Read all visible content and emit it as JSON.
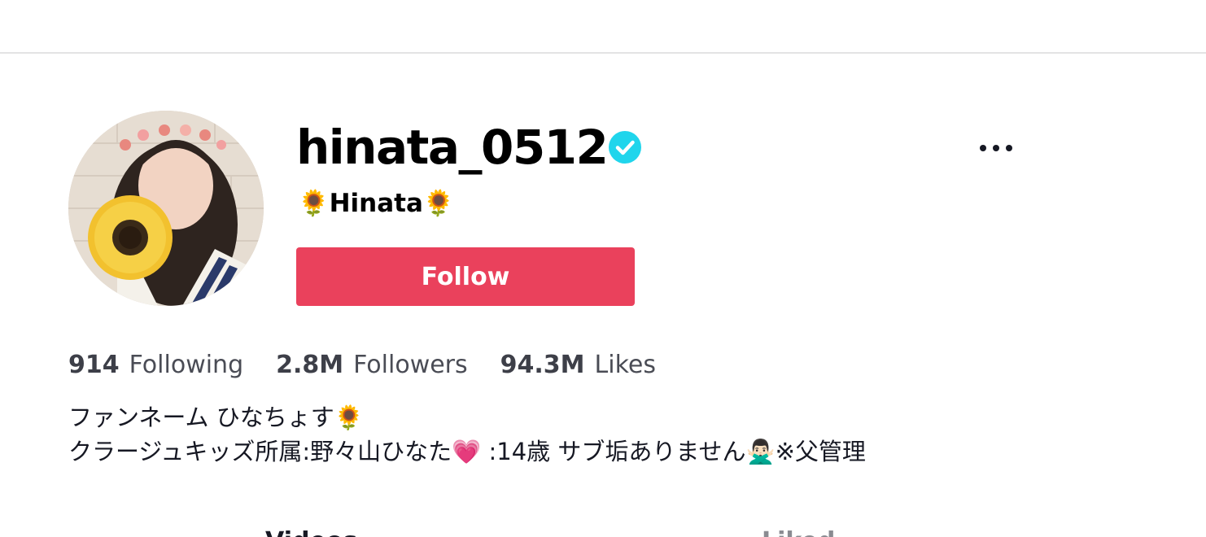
{
  "profile": {
    "username": "hinata_0512",
    "display_name": "🌻Hinata🌻",
    "follow_label": "Follow",
    "verified_color": "#20d5ec"
  },
  "stats": {
    "following_count": "914",
    "following_label": "Following",
    "followers_count": "2.8M",
    "followers_label": "Followers",
    "likes_count": "94.3M",
    "likes_label": "Likes"
  },
  "bio": {
    "line1": "ファンネーム ひなちょす🌻",
    "line2": "クラージュキッズ所属:野々山ひなた💗 :14歳 サブ垢ありません🙅🏻‍♂️※父管理"
  },
  "tabs": {
    "videos": "Videos",
    "liked": "Liked"
  },
  "colors": {
    "follow_button": "#ea415c",
    "divider": "#e3e3e4"
  },
  "icons": {
    "verified": "verified-check-icon",
    "more": "more-horizontal-icon"
  }
}
